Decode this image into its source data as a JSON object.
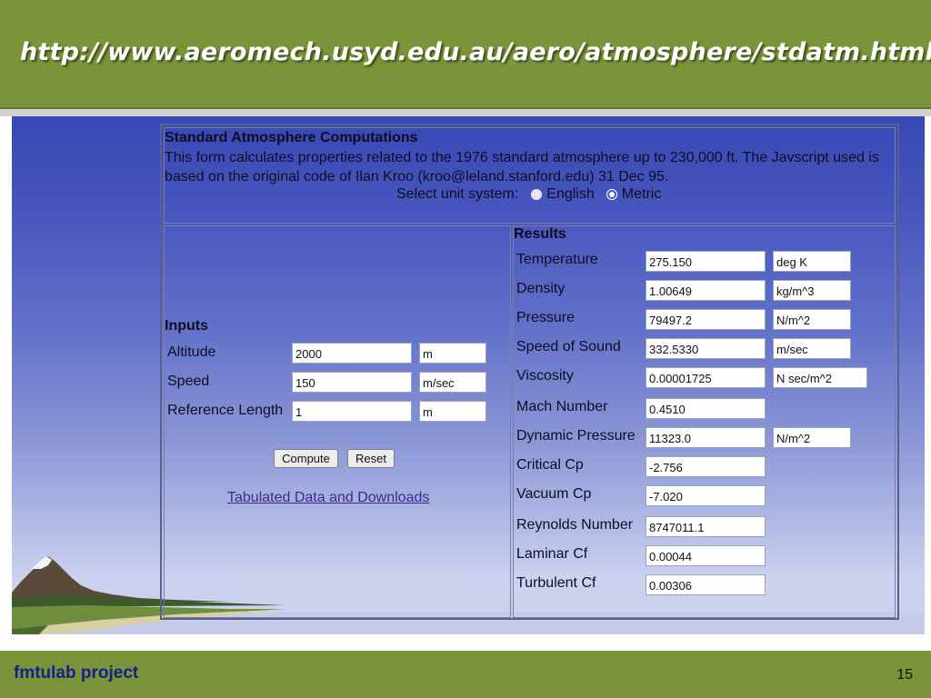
{
  "slide": {
    "title_url": "http://www.aeromech.usyd.edu.au/aero/atmosphere/stdatm.html",
    "footer_project": "fmtulab project",
    "page_number": "15"
  },
  "form": {
    "title": "Standard Atmosphere Computations",
    "description": "This form calculates properties related to the 1976 standard atmosphere up to 230,000 ft. The Javscript used is based on the original code of Ilan Kroo (kroo@leland.stanford.edu) 31 Dec 95.",
    "unit_system": {
      "label": "Select unit system:",
      "options": [
        "English",
        "Metric"
      ],
      "selected": "Metric"
    },
    "inputs": {
      "heading": "Inputs",
      "rows": [
        {
          "label": "Altitude",
          "value": "2000",
          "unit": "m"
        },
        {
          "label": "Speed",
          "value": "150",
          "unit": "m/sec"
        },
        {
          "label": "Reference Length",
          "value": "1",
          "unit": "m"
        }
      ],
      "compute_label": "Compute",
      "reset_label": "Reset",
      "link_text": "Tabulated Data and Downloads "
    },
    "results": {
      "heading": "Results",
      "rows": [
        {
          "label": "Temperature",
          "value": "275.150",
          "unit": "deg K"
        },
        {
          "label": "Density",
          "value": "1.00649",
          "unit": "kg/m^3"
        },
        {
          "label": "Pressure",
          "value": "79497.2",
          "unit": "N/m^2"
        },
        {
          "label": "Speed of Sound",
          "value": "332.5330",
          "unit": "m/sec"
        },
        {
          "label": "Viscosity",
          "value": "0.00001725",
          "unit": "N sec/m^2"
        },
        {
          "label": "Mach Number",
          "value": "0.4510",
          "unit": ""
        },
        {
          "label": "Dynamic Pressure",
          "value": "11323.0",
          "unit": "N/m^2"
        },
        {
          "label": "Critical Cp",
          "value": "-2.756",
          "unit": ""
        },
        {
          "label": "Vacuum Cp",
          "value": "-7.020",
          "unit": ""
        },
        {
          "label": "Reynolds Number",
          "value": "8747011.1",
          "unit": ""
        },
        {
          "label": "Laminar Cf",
          "value": "0.00044",
          "unit": ""
        },
        {
          "label": "Turbulent Cf",
          "value": "0.00306",
          "unit": ""
        }
      ]
    }
  },
  "colors": {
    "bar_green": "#7b943a",
    "sky_blue": "#3848b4",
    "footer_text": "#15208a",
    "link": "#3d2a8c"
  }
}
